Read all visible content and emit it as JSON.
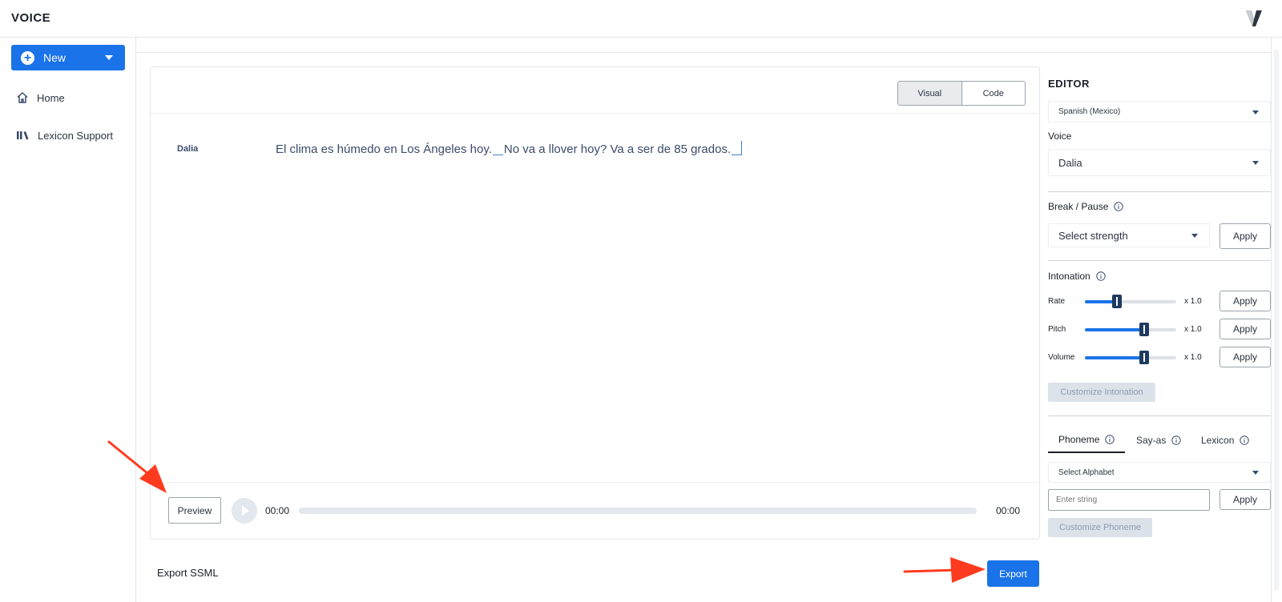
{
  "app": {
    "title": "VOICE"
  },
  "sidebar": {
    "new_label": "New",
    "items": [
      {
        "label": "Home",
        "icon": "home-icon"
      },
      {
        "label": "Lexicon Support",
        "icon": "library-icon"
      }
    ]
  },
  "editor": {
    "view_toggle": [
      "Visual",
      "Code"
    ],
    "active_view": "Visual",
    "voice_tag": "Dalia",
    "text_segments": [
      "El clima es húmedo en Los Ángeles hoy.",
      "No va a llover hoy? Va a ser de 85 grados."
    ]
  },
  "player": {
    "preview_label": "Preview",
    "time_start": "00:00",
    "time_end": "00:00"
  },
  "footer": {
    "export_ssml_label": "Export SSML",
    "export_label": "Export"
  },
  "panel": {
    "title": "EDITOR",
    "language": "Spanish (Mexico)",
    "voice_label": "Voice",
    "voice_value": "Dalia",
    "break_label": "Break / Pause",
    "break_placeholder": "Select strength",
    "apply_label": "Apply",
    "intonation_label": "Intonation",
    "sliders": [
      {
        "name": "Rate",
        "multiplier": "x 1.0",
        "level": 0.35
      },
      {
        "name": "Pitch",
        "multiplier": "x 1.0",
        "level": 0.65
      },
      {
        "name": "Volume",
        "multiplier": "x 1.0",
        "level": 0.65
      }
    ],
    "customize_intonation_label": "Customize Intonation",
    "tabs": [
      "Phoneme",
      "Say-as",
      "Lexicon"
    ],
    "active_tab": "Phoneme",
    "alphabet_placeholder": "Select Alphabet",
    "string_placeholder": "Enter string",
    "customize_phoneme_label": "Customize Phoneme"
  },
  "colors": {
    "accent": "#1a73e8",
    "annotation_arrow": "#ff3b1f"
  }
}
